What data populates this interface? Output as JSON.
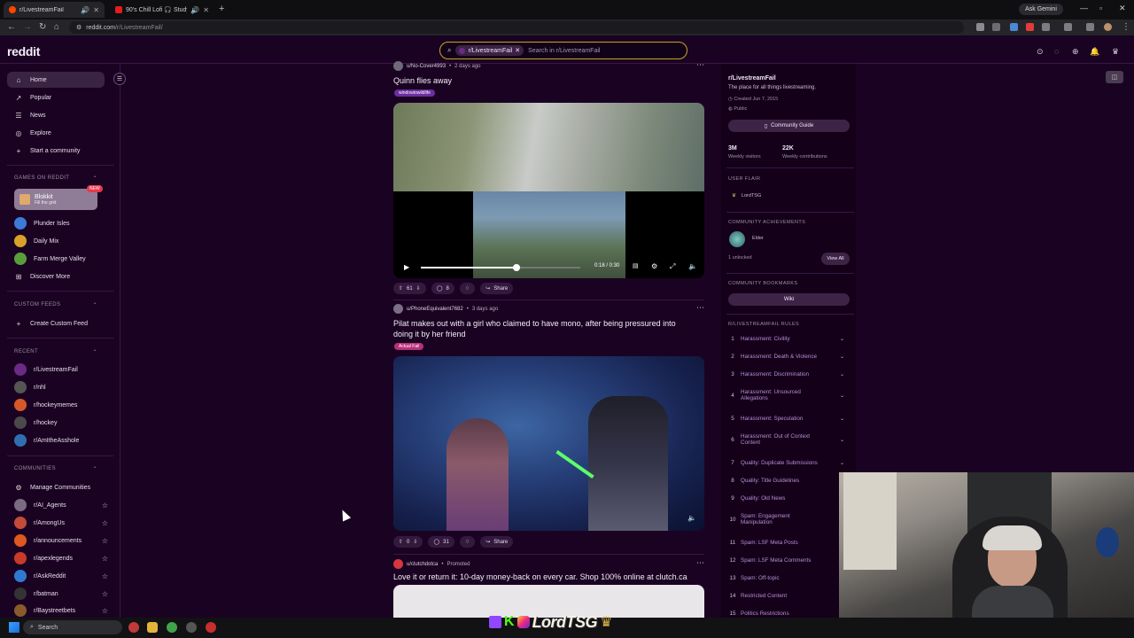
{
  "browser": {
    "tabs": [
      {
        "title": "r/LivestreamFail",
        "active": true
      },
      {
        "title": "90's Chill Lofi 🎧 Study Mu...",
        "active": false
      }
    ],
    "ask_gemini": "Ask Gemini",
    "url_host": "reddit.com",
    "url_path": "/r/LivestreamFail/"
  },
  "header": {
    "logo": "reddit",
    "search_chip": "r/LivestreamFail",
    "search_placeholder": "Search in r/LivestreamFail"
  },
  "sidebar": {
    "main": [
      {
        "label": "Home",
        "icon": "home-icon",
        "glyph": "⌂"
      },
      {
        "label": "Popular",
        "icon": "popular-icon",
        "glyph": "↗"
      },
      {
        "label": "News",
        "icon": "news-icon",
        "glyph": "☰"
      },
      {
        "label": "Explore",
        "icon": "explore-icon",
        "glyph": "◎"
      },
      {
        "label": "Start a community",
        "icon": "plus-icon",
        "glyph": "+"
      }
    ],
    "games_heading": "GAMES ON REDDIT",
    "featured_game": {
      "title": "Blokkit",
      "subtitle": "Fill the grid",
      "badge": "NEW"
    },
    "games": [
      {
        "label": "Plunder Isles",
        "color": "#3b7bd6"
      },
      {
        "label": "Daily Mix",
        "color": "#d9a12b"
      },
      {
        "label": "Farm Merge Valley",
        "color": "#5a9e3c"
      }
    ],
    "discover_more": "Discover More",
    "custom_feeds_heading": "CUSTOM FEEDS",
    "create_custom_feed": "Create Custom Feed",
    "recent_heading": "RECENT",
    "recent": [
      {
        "label": "r/LivestreamFail",
        "color": "#6a2a86"
      },
      {
        "label": "r/nhl",
        "color": "#555555"
      },
      {
        "label": "r/hockeymemes",
        "color": "#d4582a"
      },
      {
        "label": "r/hockey",
        "color": "#4a4a4a"
      },
      {
        "label": "r/AmItheAsshole",
        "color": "#2f6fb0"
      }
    ],
    "communities_heading": "COMMUNITIES",
    "manage_communities": "Manage Communities",
    "communities": [
      {
        "label": "r/AI_Agents",
        "color": "#7a6b82"
      },
      {
        "label": "r/AmongUs",
        "color": "#c44a3a"
      },
      {
        "label": "r/announcements",
        "color": "#e0581f"
      },
      {
        "label": "r/apexlegends",
        "color": "#c83a2a"
      },
      {
        "label": "r/AskReddit",
        "color": "#2f7ad1"
      },
      {
        "label": "r/batman",
        "color": "#333333"
      },
      {
        "label": "r/Baystreetbets",
        "color": "#8a5a2a"
      }
    ]
  },
  "posts": [
    {
      "author": "u/No-Cover4993",
      "time": "2 days ago",
      "title": "Quinn flies away",
      "flair": "windowtowildlife",
      "video_time": "0:18 / 0:30",
      "video_progress": 0.6,
      "votes": "61",
      "comments": "8",
      "share": "Share"
    },
    {
      "author": "u/PhoneEquivalent7682",
      "time": "3 days ago",
      "title_line1": "Pilat makes out with a girl who claimed to have mono, after being pressured into",
      "title_line2": "doing it by her friend",
      "flair": "Actual Fail",
      "votes": "0",
      "comments": "31",
      "share": "Share"
    },
    {
      "author": "u/clutchdotca",
      "promoted": "Promoted",
      "title": "Love it or return it: 10-day money-back on every car. Shop 100% online at clutch.ca"
    }
  ],
  "right": {
    "name": "r/LivestreamFail",
    "description": "The place for all things livestreaming.",
    "created": "Created Jun 7, 2015",
    "visibility": "Public",
    "guide_button": "Community Guide",
    "stat1_value": "3M",
    "stat1_label": "Weekly visitors",
    "stat2_value": "22K",
    "stat2_label": "Weekly contributions",
    "user_flair_heading": "USER FLAIR",
    "user_flair": "LordTSG",
    "achievements_heading": "COMMUNITY ACHIEVEMENTS",
    "achievement": "Elder",
    "unlocked": "1 unlocked",
    "view_all": "View All",
    "bookmarks_heading": "COMMUNITY BOOKMARKS",
    "wiki": "Wiki",
    "rules_heading": "R/LIVESTREAMFAIL RULES",
    "rules": [
      {
        "n": "1",
        "line1": "Harassment: Civility",
        "line2": ""
      },
      {
        "n": "2",
        "line1": "Harassment: Death & Violence",
        "line2": ""
      },
      {
        "n": "3",
        "line1": "Harassment: Discrimination",
        "line2": ""
      },
      {
        "n": "4",
        "line1": "Harassment: Unsourced",
        "line2": "Allegations"
      },
      {
        "n": "5",
        "line1": "Harassment: Speculation",
        "line2": ""
      },
      {
        "n": "6",
        "line1": "Harassment: Out of Context",
        "line2": "Content"
      },
      {
        "n": "7",
        "line1": "Quality: Duplicate Submissions",
        "line2": ""
      },
      {
        "n": "8",
        "line1": "Quality: Title Guidelines",
        "line2": ""
      },
      {
        "n": "9",
        "line1": "Quality: Old News",
        "line2": ""
      },
      {
        "n": "10",
        "line1": "Spam: Engagement",
        "line2": "Manipulation"
      },
      {
        "n": "11",
        "line1": "Spam: LSF Meta Posts",
        "line2": ""
      },
      {
        "n": "12",
        "line1": "Spam: LSF Meta Comments",
        "line2": ""
      },
      {
        "n": "13",
        "line1": "Spam: Off-topic",
        "line2": ""
      },
      {
        "n": "14",
        "line1": "Restricted Content",
        "line2": ""
      },
      {
        "n": "15",
        "line1": "Politics Restrictions",
        "line2": ""
      }
    ]
  },
  "taskbar": {
    "search": "Search",
    "stream_name": "LordTSG"
  }
}
